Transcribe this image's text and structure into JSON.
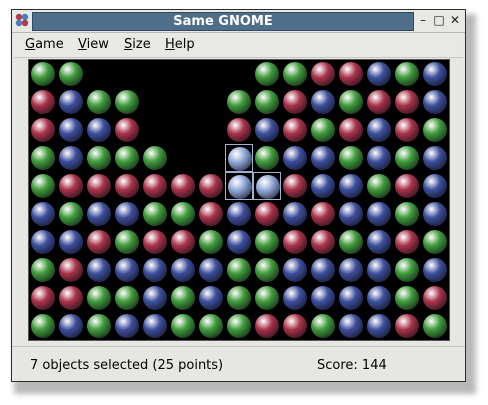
{
  "window": {
    "title": "Same GNOME",
    "buttons": [
      "minimize",
      "maximize",
      "close"
    ]
  },
  "menubar": {
    "items": [
      {
        "label": "Game",
        "accel": "G"
      },
      {
        "label": "View",
        "accel": "V"
      },
      {
        "label": "Size",
        "accel": "S"
      },
      {
        "label": "Help",
        "accel": "H"
      }
    ]
  },
  "board": {
    "columns": 15,
    "rows": 10,
    "grid": [
      "GGxxxxxxGGRRBGB",
      "RBGGxxxGGRBGRRB",
      "RBBRxxxRBRGRBRG",
      "GBGGGxxbGBBGBGB",
      "GRRRRRRbbRBBGRB",
      "BGBBGGRBRBRBBGB",
      "BBRGRRGBGRRGBRG",
      "GRBBBBBGGBBBBGB",
      "RRGGBGBGGBBBBGR",
      "GBGBBGGGRRGBBRG"
    ],
    "legend": {
      "G": "green",
      "R": "red",
      "B": "blue",
      "b": "blue-selected",
      "x": "empty"
    },
    "colors": {
      "green": "#3f9a3a",
      "red": "#a8324a",
      "blue": "#3d4f9c",
      "selected": "#8ea6d6"
    }
  },
  "status": {
    "message": "7 objects selected (25 points)",
    "score_text": "Score: 144"
  }
}
